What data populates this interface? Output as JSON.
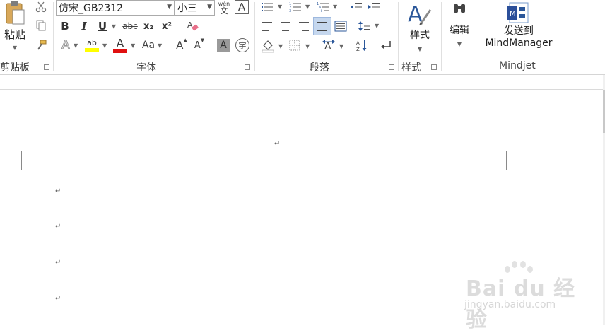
{
  "clipboard": {
    "paste_label": "粘贴",
    "group_label": "剪贴板"
  },
  "font": {
    "font_name": "仿宋_GB2312",
    "font_size": "小三",
    "phonetic_glyph_top": "wén",
    "phonetic_glyph_bottom": "文",
    "char_border_glyph": "A",
    "bold": "B",
    "italic": "I",
    "underline": "U",
    "strikethrough": "abc",
    "subscript": "x₂",
    "superscript": "x²",
    "text_effects": "A",
    "highlight_glyph": "ab",
    "font_color_glyph": "A",
    "change_case": "Aa",
    "grow_font": "A",
    "shrink_font": "A",
    "char_shading": "A",
    "enclose_char": "字",
    "group_label": "字体",
    "highlight_color": "#ffff00",
    "font_color": "#e01010"
  },
  "paragraph": {
    "group_label": "段落"
  },
  "styles": {
    "label": "样式",
    "group_label": "样式"
  },
  "editing": {
    "label": "编辑"
  },
  "mindjet": {
    "send_label_line1": "发送到",
    "send_label_line2": "MindManager",
    "group_label": "Mindjet"
  },
  "document": {
    "paragraph_mark": "↵"
  },
  "watermark": {
    "brand": "Bai du 经验",
    "url": "jingyan.baidu.com"
  },
  "colors": {
    "accent_blue": "#2b579a",
    "selected_bg": "#c5d7ee"
  }
}
